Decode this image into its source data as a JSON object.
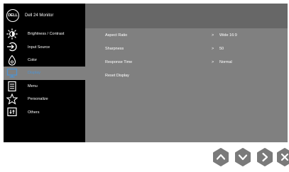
{
  "osd": {
    "title": "Dell 24 Monitor",
    "logo": "DELL"
  },
  "menu": [
    {
      "label": "Brightness / Contrast",
      "icon": "brightness-icon"
    },
    {
      "label": "Input Source",
      "icon": "input-source-icon"
    },
    {
      "label": "Color",
      "icon": "color-icon"
    },
    {
      "label": "Display",
      "icon": "display-icon",
      "selected": true
    },
    {
      "label": "Menu",
      "icon": "menu-icon"
    },
    {
      "label": "Personalize",
      "icon": "star-icon"
    },
    {
      "label": "Others",
      "icon": "others-icon"
    }
  ],
  "display_settings": [
    {
      "label": "Aspect Ratio",
      "arrow": ">",
      "value": "Wide 16:9"
    },
    {
      "label": "Sharpness",
      "arrow": ">",
      "value": "50"
    },
    {
      "label": "Response Time",
      "arrow": ">",
      "value": "Normal"
    },
    {
      "label": "Reset Display",
      "arrow": "",
      "value": ""
    }
  ],
  "buttons": [
    {
      "icon": "up-icon"
    },
    {
      "icon": "down-icon"
    },
    {
      "icon": "right-icon"
    },
    {
      "icon": "close-icon"
    }
  ],
  "colors": {
    "panel_bg": "#808080",
    "sidebar_bg": "#000000",
    "header_bg": "#676767",
    "selected_text": "#4d94d4",
    "button_fill": "#7a7a7a"
  }
}
